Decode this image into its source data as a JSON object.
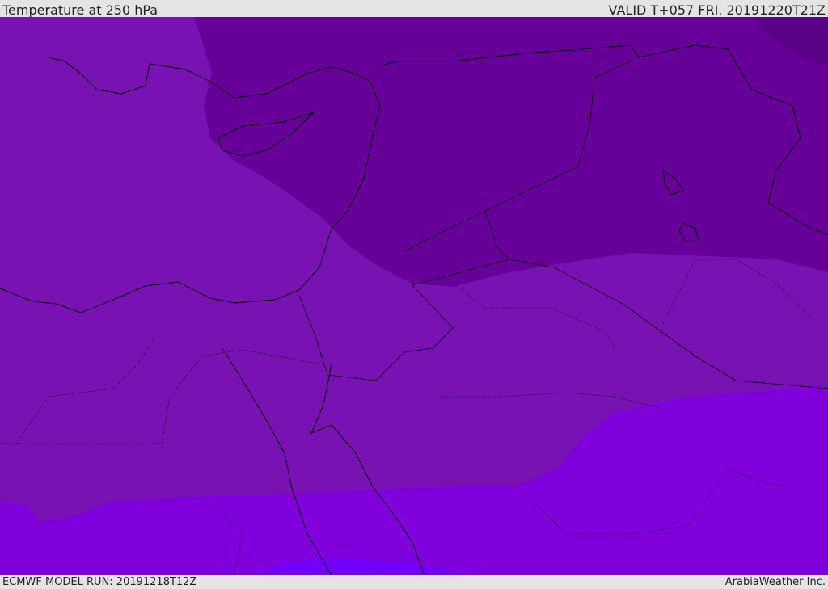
{
  "header": {
    "title": "Temperature at 250 hPa",
    "valid": "VALID T+057 FRI. 20191220T21Z"
  },
  "footer": {
    "model_run": "ECMWF MODEL RUN: 20191218T12Z",
    "brand": "ArabiaWeather Inc."
  },
  "map": {
    "colors": {
      "band_mid": "#7912b2",
      "band_cold": "#660099",
      "band_coldest": "#5a0087",
      "band_warm": "#8000dc",
      "band_warmest": "#7200ff",
      "coast": "#000000"
    }
  }
}
